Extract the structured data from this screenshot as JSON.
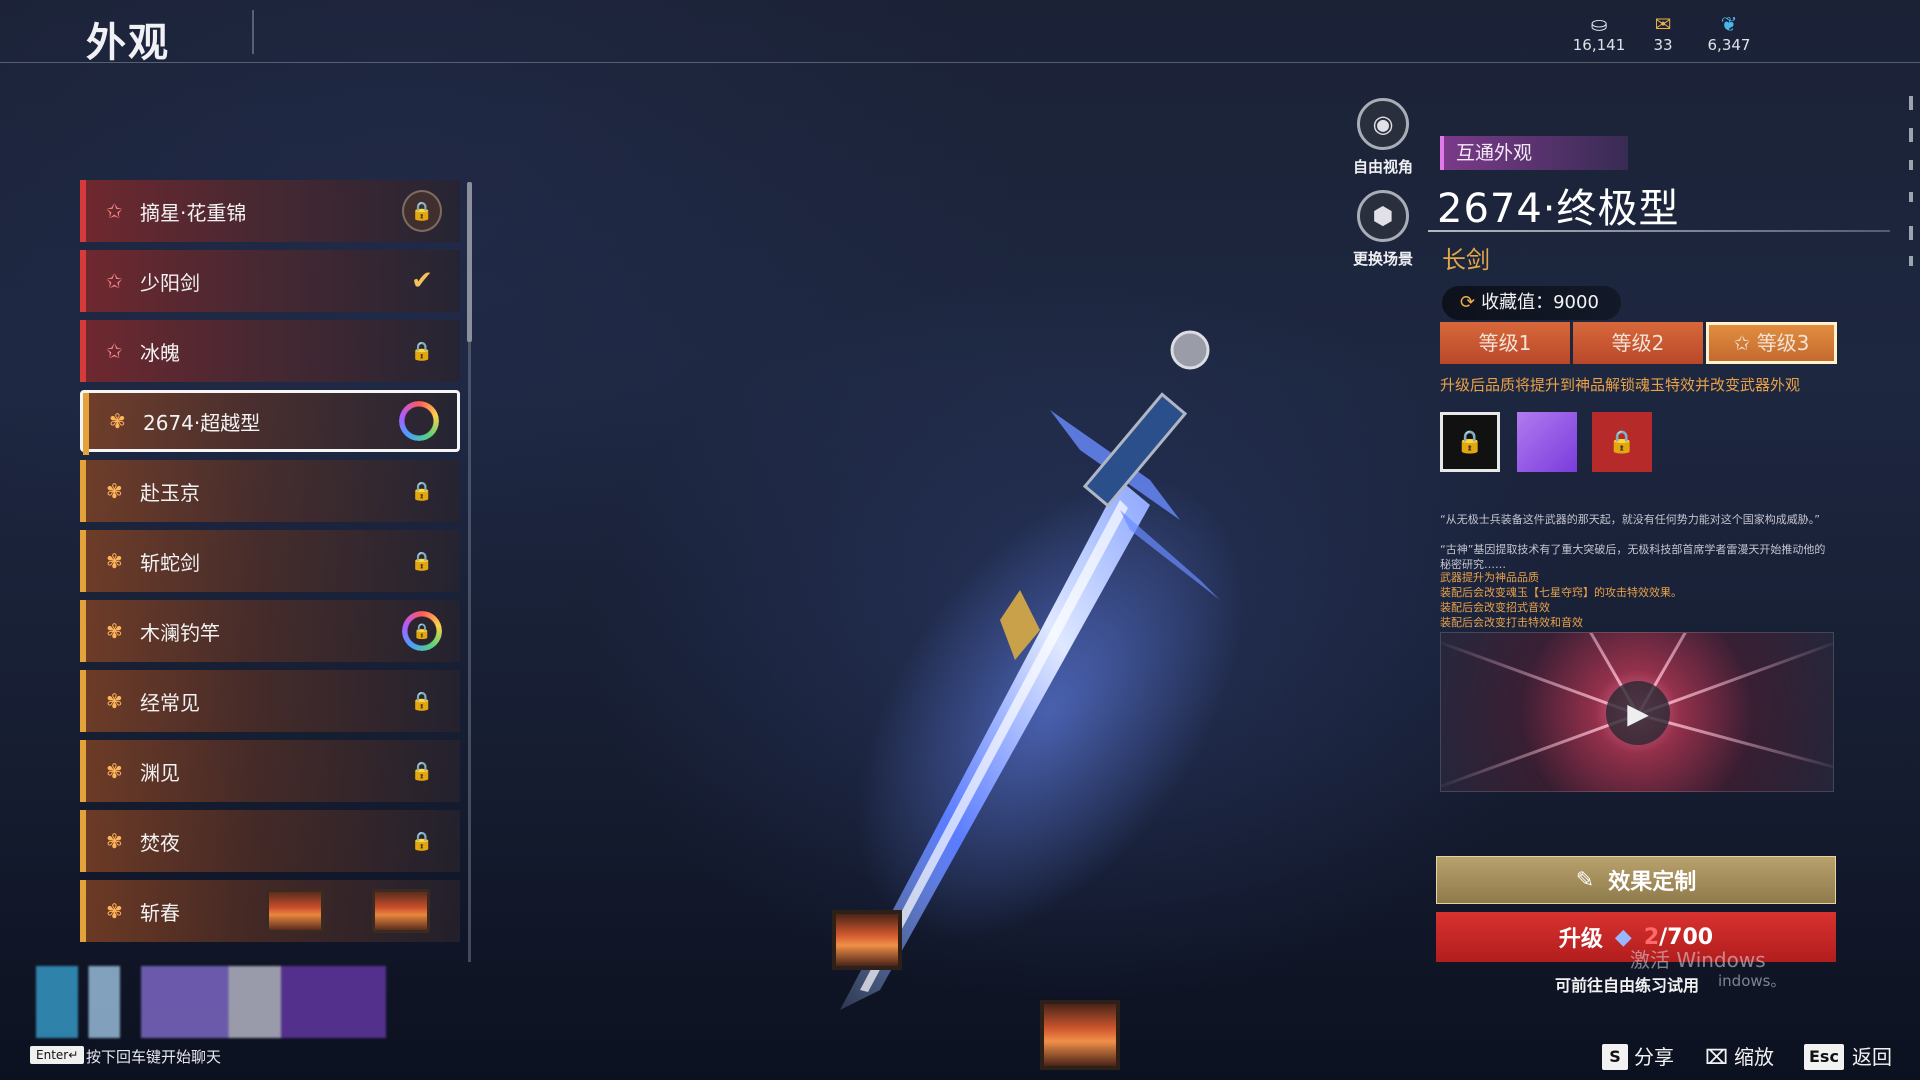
{
  "header": {
    "title": "外观",
    "currencies": [
      {
        "icon": "coin-icon",
        "value": "16,141"
      },
      {
        "icon": "ticket-icon",
        "value": "33"
      },
      {
        "icon": "feather-icon",
        "value": "6,347"
      }
    ]
  },
  "list": {
    "items": [
      {
        "label": "摘星·花重锦",
        "tier": "red",
        "state": "locked-emblem"
      },
      {
        "label": "少阳剑",
        "tier": "red",
        "state": "equipped"
      },
      {
        "label": "冰魄",
        "tier": "red",
        "state": "locked"
      },
      {
        "label": "2674·超越型",
        "tier": "gold",
        "state": "selected-ring"
      },
      {
        "label": "赴玉京",
        "tier": "gold",
        "state": "locked"
      },
      {
        "label": "斩蛇剑",
        "tier": "gold",
        "state": "locked"
      },
      {
        "label": "木澜钓竿",
        "tier": "gold",
        "state": "locked-ring"
      },
      {
        "label": "经常见",
        "tier": "gold",
        "state": "locked"
      },
      {
        "label": "渊见",
        "tier": "gold",
        "state": "locked"
      },
      {
        "label": "焚夜",
        "tier": "gold",
        "state": "locked"
      },
      {
        "label": "斩春",
        "tier": "gold",
        "state": "lanterns"
      }
    ]
  },
  "view": {
    "free_camera_label": "自由视角",
    "change_scene_label": "更换场景"
  },
  "detail": {
    "tag": "互通外观",
    "name": "2674·终极型",
    "type": "长剑",
    "collection": "收藏值：9000",
    "levels": [
      "等级1",
      "等级2",
      "等级3"
    ],
    "active_level": "等级3",
    "upgrade_note": "升级后品质将提升到神品解锁魂玉特效并改变武器外观",
    "description_lines": [
      "“从无极士兵装备这件武器的那天起，就没有任何势力能对这个国家构成威胁。”",
      "“古神”基因提取技术有了重大突破后，无极科技部首席学者雷漫天开始推动他的秘密研究……"
    ],
    "effect_lines": [
      "武器提升为神品品质",
      "装配后会改变魂玉【七星夺窍】的攻击特效效果。",
      "装配后会改变招式音效",
      "装配后会改变打击特效和音效"
    ],
    "effect_button": "效果定制",
    "upgrade_button": "升级",
    "upgrade_cost_current": "2",
    "upgrade_cost_total": "/700",
    "try_hint": "可前往自由练习试用",
    "watermark_line1": "激活 Windows",
    "watermark_line2": "indows。"
  },
  "bottom": {
    "enter_key": "Enter↵",
    "chat_hint": "按下回车键开始聊天",
    "share_key": "S",
    "share_label": "分享",
    "zoom_label": "缩放",
    "esc_key": "Esc",
    "back_label": "返回"
  },
  "colors": {
    "red_tier": "#d63a3a",
    "gold_tier": "#e3a23a",
    "accent_orange": "#e9a24a",
    "upgrade_red": "#c42626"
  }
}
